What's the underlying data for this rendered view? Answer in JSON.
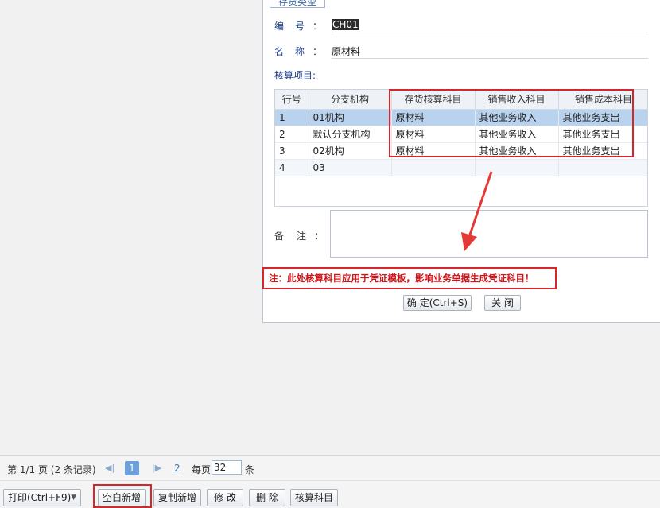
{
  "dialog": {
    "tab_label": "存货类型",
    "code": {
      "label": "编　号",
      "colon": "：",
      "value": "CH01"
    },
    "name": {
      "label": "名　称",
      "colon": "：",
      "value": "原材料"
    },
    "section_label": "核算项目:",
    "grid": {
      "columns": [
        "行号",
        "分支机构",
        "存货核算科目",
        "销售收入科目",
        "销售成本科目"
      ],
      "rows": [
        [
          "1",
          "01机构",
          "原材料",
          "其他业务收入",
          "其他业务支出"
        ],
        [
          "2",
          "默认分支机构",
          "原材料",
          "其他业务收入",
          "其他业务支出"
        ],
        [
          "3",
          "02机构",
          "原材料",
          "其他业务收入",
          "其他业务支出"
        ],
        [
          "4",
          "03",
          "",
          "",
          ""
        ]
      ]
    },
    "remark": {
      "label": "备　注",
      "colon": "：",
      "value": ""
    },
    "note": "注：此处核算科目应用于凭证模板，影响业务单据生成凭证科目！",
    "confirm_button": "确 定(Ctrl+S)",
    "close_button": "关 闭"
  },
  "pager": {
    "summary": "第 1/1 页 (2 条记录)",
    "current_page": "1",
    "page2_link": "2",
    "per_page_label": "每页",
    "per_page_value": "32",
    "per_page_unit": "条"
  },
  "toolbar": {
    "print": "打印(Ctrl+F9)",
    "blank_new": "空白新增",
    "copy_new": "复制新增",
    "edit": "修 改",
    "delete": "删 除",
    "accounting_subject": "核算科目"
  },
  "colors": {
    "highlight_red": "#d7262a",
    "selected_row": "#b9d3ef",
    "label_blue": "#1e3f8a"
  }
}
